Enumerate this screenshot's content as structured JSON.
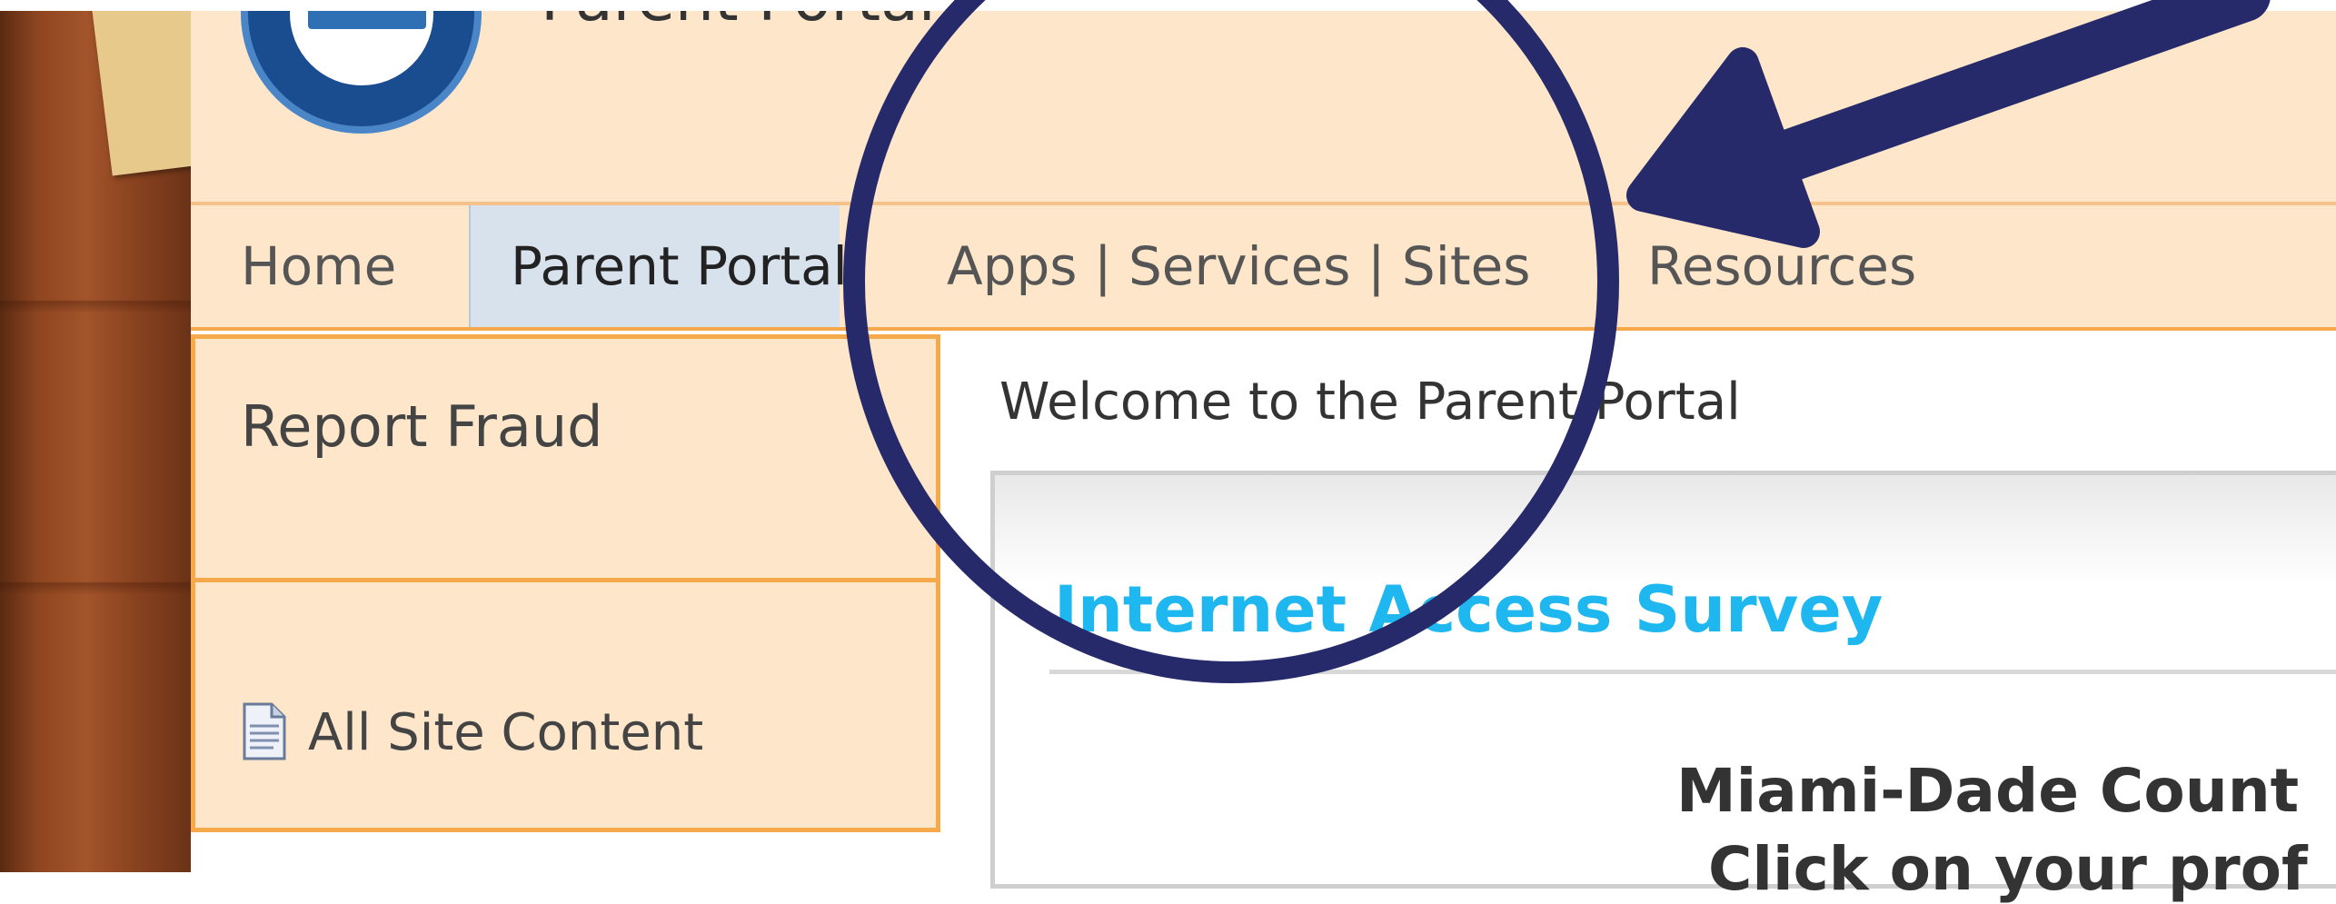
{
  "header": {
    "site_title": "Parent Portal"
  },
  "nav": {
    "items": [
      {
        "label": "Home"
      },
      {
        "label": "Parent Portal"
      },
      {
        "label": "Apps | Services | Sites"
      },
      {
        "label": "Resources"
      }
    ]
  },
  "quick_launch": {
    "report_fraud": "Report Fraud",
    "all_site_content": "All Site Content"
  },
  "main": {
    "welcome": "Welcome to the Parent Portal",
    "survey_title": "Internet Access Survey",
    "body_line1": "Miami-Dade Count",
    "body_line2": "Click on your prof"
  },
  "colors": {
    "header_bg": "#fde6c9",
    "nav_border": "#f5a94a",
    "selected_tab": "#d8e2ec",
    "link_blue": "#1eb7f0",
    "annotation": "#262a6a"
  }
}
